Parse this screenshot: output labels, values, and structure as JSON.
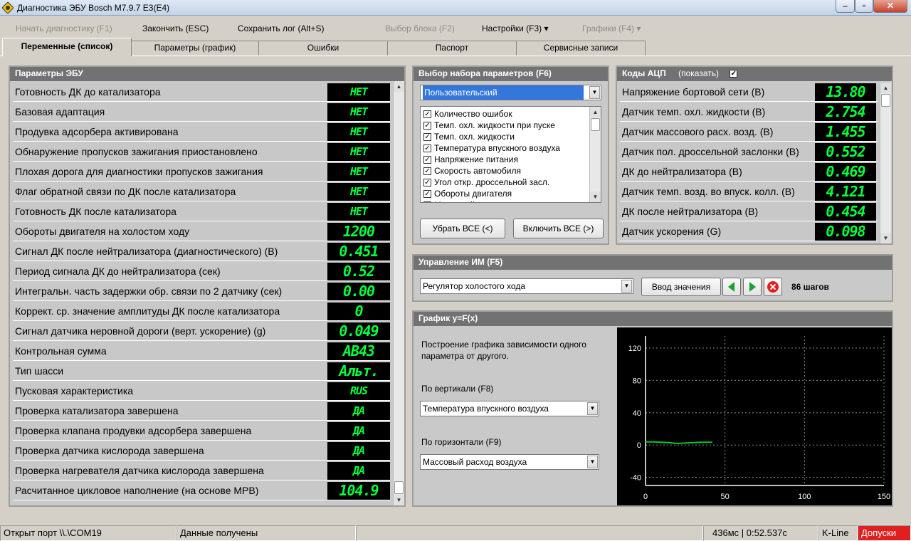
{
  "window": {
    "title": "Диагностика ЭБУ Bosch M7.9.7 E3(E4)",
    "min": "‒",
    "max": "▫",
    "close": "✕"
  },
  "menu": [
    {
      "label": "Начать диагностику (F1)",
      "disabled": true
    },
    {
      "label": "Закончить (ESC)",
      "disabled": false
    },
    {
      "label": "Сохранить лог (Alt+S)",
      "disabled": false
    },
    {
      "label": "Выбор блока (F2)",
      "disabled": true
    },
    {
      "label": "Настройки (F3) ▾",
      "disabled": false
    },
    {
      "label": "Графики (F4) ▾",
      "disabled": true
    }
  ],
  "tabs": [
    "Переменные (список)",
    "Параметры (график)",
    "Ошибки",
    "Паспорт",
    "Сервисные записи"
  ],
  "ecu": {
    "title": "Параметры ЭБУ",
    "rows": [
      {
        "label": "Готовность ДК до катализатора",
        "value": "НЕТ"
      },
      {
        "label": "Базовая адаптация",
        "value": "НЕТ"
      },
      {
        "label": "Продувка адсорбера активирована",
        "value": "НЕТ"
      },
      {
        "label": "Обнаружение пропусков зажигания приостановлено",
        "value": "НЕТ"
      },
      {
        "label": "Плохая дорога для диагностики пропусков зажигания",
        "value": "НЕТ"
      },
      {
        "label": "Флаг обратной связи по ДК после катализатора",
        "value": "НЕТ"
      },
      {
        "label": "Готовность ДК после катализатора",
        "value": "НЕТ"
      },
      {
        "label": "Обороты двигателя на холостом ходу",
        "value": "1200"
      },
      {
        "label": "Сигнал ДК после нейтрализатора (диагностического) (В)",
        "value": "0.451"
      },
      {
        "label": "Период сигнала ДК до нейтрализатора (сек)",
        "value": "0.52"
      },
      {
        "label": "Интегральн. часть задержки обр. связи по 2 датчику (сек)",
        "value": "0.00"
      },
      {
        "label": "Коррект. ср. значение амплитуды ДК после катализатора",
        "value": "0"
      },
      {
        "label": "Сигнал датчика неровной дороги (верт. ускорение) (g)",
        "value": "0.049"
      },
      {
        "label": "Контрольная сумма",
        "value": "AB43"
      },
      {
        "label": "Тип шасси",
        "value": "Альт."
      },
      {
        "label": "Пусковая характеристика",
        "value": "RUS"
      },
      {
        "label": "Проверка катализатора завершена",
        "value": "ДА"
      },
      {
        "label": "Проверка клапана продувки адсорбера завершена",
        "value": "ДА"
      },
      {
        "label": "Проверка датчика кислорода завершена",
        "value": "ДА"
      },
      {
        "label": "Проверка нагревателя датчика кислорода завершена",
        "value": "ДА"
      },
      {
        "label": "Расчитанное цикловое наполнение (на основе MPB)",
        "value": "104.9"
      }
    ]
  },
  "paramset": {
    "title": "Выбор набора параметров (F6)",
    "selected": "Пользовательский",
    "items": [
      "Количество ошибок",
      "Темп. охл. жидкости при пуске",
      "Темп. охл. жидкости",
      "Температура впускного воздуха",
      "Напряжение питания",
      "Скорость автомобиля",
      "Угол откр. дроссельной засл.",
      "Обороты двигателя",
      "Массовый расход воздуха"
    ],
    "btn_remove": "Убрать ВСЕ (<)",
    "btn_add": "Включить ВСЕ (>)"
  },
  "adc": {
    "title": "Коды АЦП",
    "show_label": "(показать)",
    "rows": [
      {
        "label": "Напряжение бортовой сети (В)",
        "value": "13.80"
      },
      {
        "label": "Датчик темп. охл. жидкости (В)",
        "value": "2.754"
      },
      {
        "label": "Датчик массового расх. возд. (В)",
        "value": "1.455"
      },
      {
        "label": "Датчик пол. дроссельной заслонки (В)",
        "value": "0.552"
      },
      {
        "label": "ДК до нейтрализатора (В)",
        "value": "0.469"
      },
      {
        "label": "Датчик темп. возд. во впуск. колл. (В)",
        "value": "4.121"
      },
      {
        "label": "ДК после нейтрализатора (В)",
        "value": "0.454"
      },
      {
        "label": "Датчик ускорения (G)",
        "value": "0.098"
      }
    ]
  },
  "actuator": {
    "title": "Управление ИМ (F5)",
    "selected": "Регулятор холостого хода",
    "input_btn": "Ввод значения",
    "steps": "86 шагов"
  },
  "graph": {
    "title": "График y=F(x)",
    "description": "Построение графика зависимости одного параметра от другого.",
    "vertical_label": "По вертикали (F8)",
    "vertical_value": "Температура впускного воздуха",
    "horizontal_label": "По горизонтали (F9)",
    "horizontal_value": "Массовый расход воздуха"
  },
  "chart_data": {
    "type": "line",
    "title": "",
    "xlabel": "",
    "ylabel": "",
    "xlim": [
      0,
      150
    ],
    "ylim": [
      -50,
      135
    ],
    "xticks": [
      0,
      50,
      100,
      150
    ],
    "yticks": [
      -40,
      0,
      40,
      80,
      120
    ],
    "grid": true,
    "series": [
      {
        "color": "#00c832",
        "x": [
          0,
          5,
          10,
          15,
          20,
          25,
          30,
          35,
          40,
          42
        ],
        "y": [
          4,
          4,
          3.5,
          3,
          2,
          2.5,
          3,
          3.5,
          3.5,
          3.5
        ]
      }
    ]
  },
  "status": {
    "port": "Открыт порт \\\\.\\COM19",
    "data": "Данные получены",
    "time": "436мс | 0:52.537с",
    "bus": "K-Line",
    "tolerances": "Допуски"
  },
  "colors": {
    "lcd": "#00ff3c",
    "header": "#727272",
    "alert": "#e02020"
  }
}
